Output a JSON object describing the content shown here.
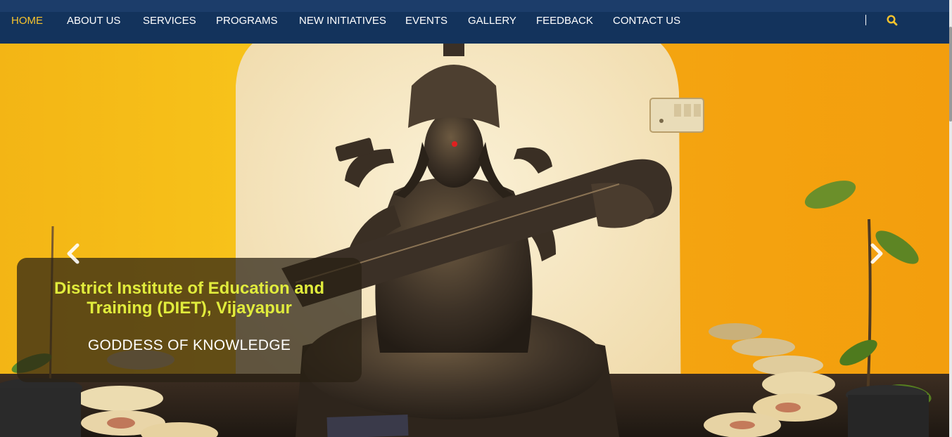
{
  "nav": {
    "items": [
      {
        "label": "HOME",
        "active": true
      },
      {
        "label": "ABOUT US",
        "active": false
      },
      {
        "label": "SERVICES",
        "active": false
      },
      {
        "label": "PROGRAMS",
        "active": false
      },
      {
        "label": "NEW INITIATIVES",
        "active": false
      },
      {
        "label": "EVENTS",
        "active": false
      },
      {
        "label": "GALLERY",
        "active": false
      },
      {
        "label": "FEEDBACK",
        "active": false
      },
      {
        "label": "CONTACT US",
        "active": false
      }
    ],
    "search_icon": "search-icon"
  },
  "hero": {
    "caption_title_line1": "District Institute of Education and",
    "caption_title_line2": "Training (DIET), Vijayapur",
    "caption_subtitle": "GODDESS OF KNOWLEDGE",
    "prev_icon": "chevron-left-icon",
    "next_icon": "chevron-right-icon"
  },
  "colors": {
    "nav_bg": "#13335c",
    "nav_active": "#f6c32d",
    "caption_title": "#e1ec3c",
    "wall_yellow": "#f5a50f",
    "alcove_cream": "#f4e6c2"
  }
}
